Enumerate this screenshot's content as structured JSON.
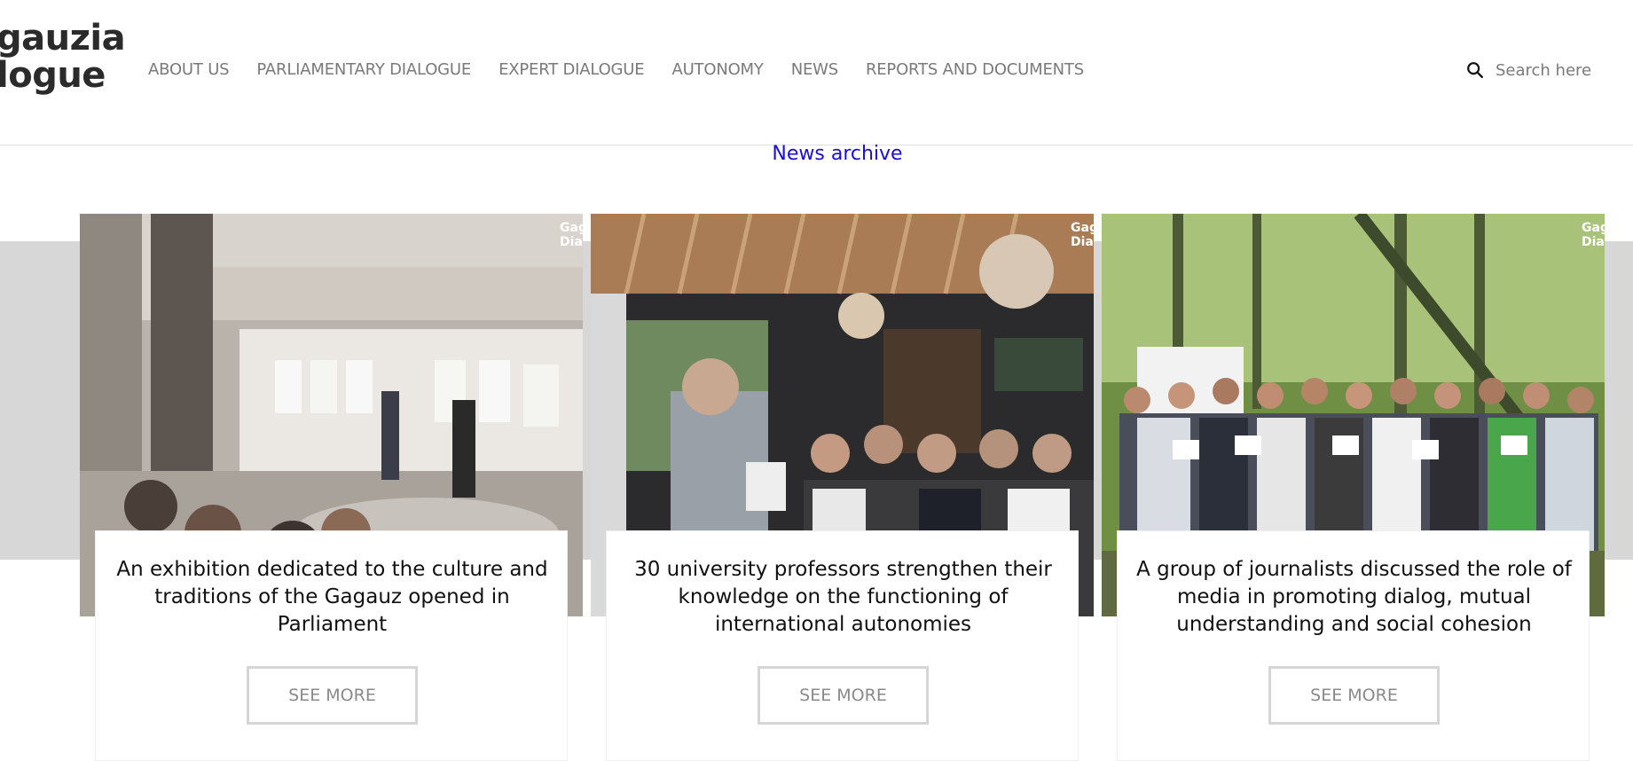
{
  "site": {
    "logo_line1": "gauzia",
    "logo_line2": "logue"
  },
  "nav": {
    "items": [
      {
        "label": "ABOUT US"
      },
      {
        "label": "PARLIAMENTARY DIALOGUE"
      },
      {
        "label": "EXPERT DIALOGUE"
      },
      {
        "label": "AUTONOMY"
      },
      {
        "label": "NEWS"
      },
      {
        "label": "REPORTS AND DOCUMENTS"
      }
    ]
  },
  "search": {
    "placeholder": "Search here",
    "icon": "search-icon"
  },
  "section": {
    "title": "News archive"
  },
  "cards": [
    {
      "title": "An exhibition dedicated to the culture and traditions of the Gagauz opened in Parliament",
      "button": "SEE MORE",
      "watermark_line1": "Gag",
      "watermark_line2": "Dia"
    },
    {
      "title": "30 university professors strengthen their knowledge on the functioning of international autonomies",
      "button": "SEE MORE",
      "watermark_line1": "Gag",
      "watermark_line2": "Dia"
    },
    {
      "title": "A group of journalists discussed the role of media in promoting dialog, mutual understanding and social cohesion",
      "button": "SEE MORE",
      "watermark_line1": "Gag",
      "watermark_line2": "Dia"
    }
  ],
  "colors": {
    "nav_text": "#7a7a7a",
    "section_title": "#1a0dda",
    "band": "#d7d7d7",
    "button_border": "#d5d5d5"
  }
}
